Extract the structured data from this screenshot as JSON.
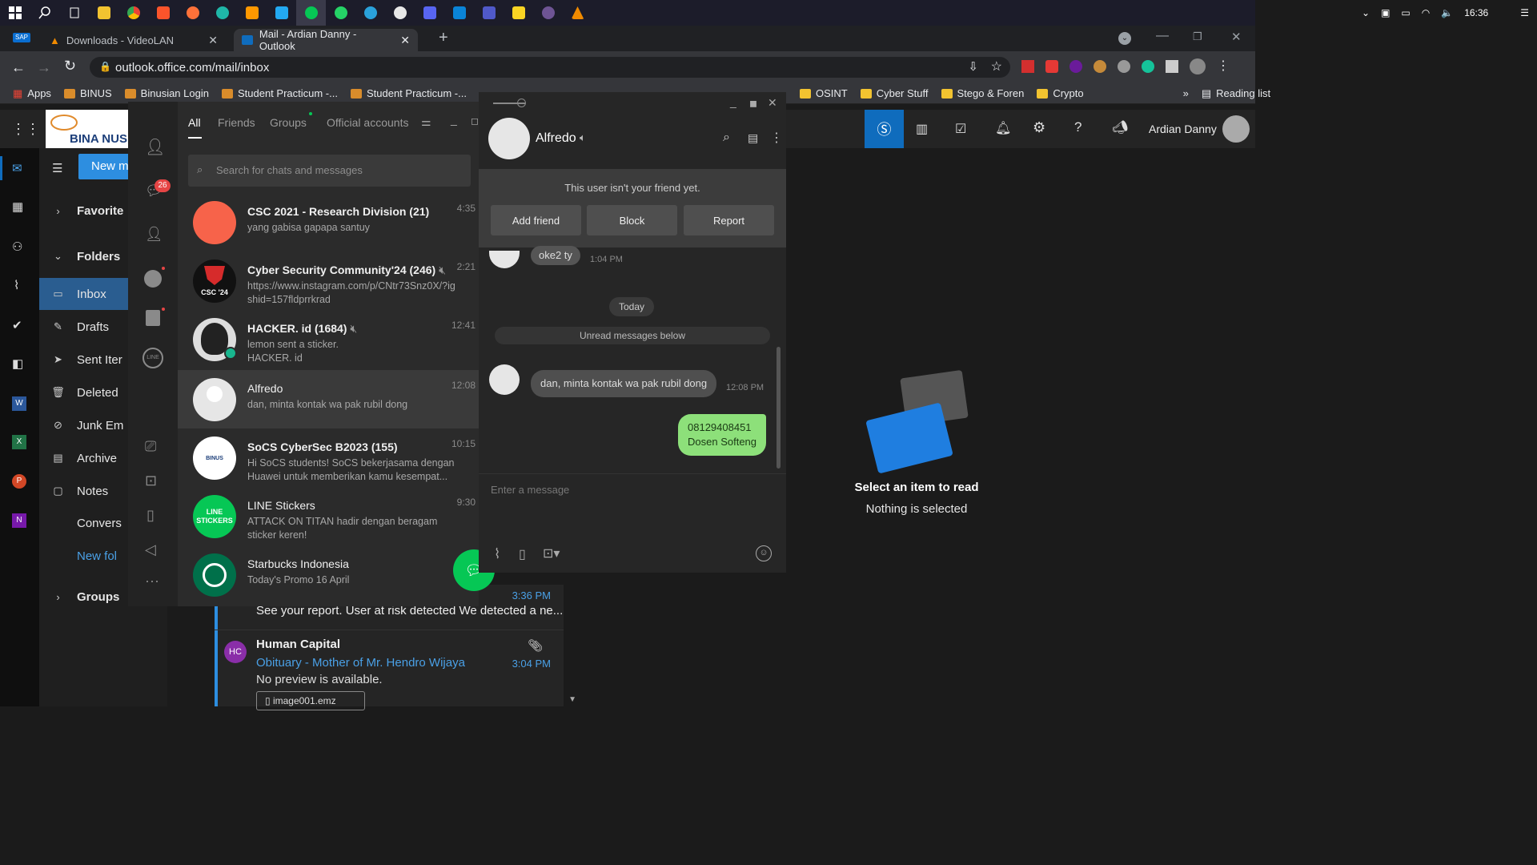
{
  "taskbar": {
    "clock": "16:36"
  },
  "browser": {
    "tabs": [
      {
        "title": "Downloads - VideoLAN"
      },
      {
        "title": "Mail - Ardian Danny - Outlook"
      }
    ],
    "url": "outlook.office.com/mail/inbox",
    "bookmarks": [
      "Apps",
      "BINUS",
      "Binusian Login",
      "Student Practicum -...",
      "Student Practicum -...",
      "OSINT",
      "Cyber Stuff",
      "Stego & Foren",
      "Crypto"
    ],
    "reading_list": "Reading list"
  },
  "outlook": {
    "user": "Ardian Danny",
    "logo_text": "BINA NUS",
    "new_message": "New m",
    "favorites": "Favorite",
    "folders": "Folders",
    "nav": [
      {
        "label": "Inbox",
        "icon": "inbox-icon"
      },
      {
        "label": "Drafts",
        "icon": "pencil-icon"
      },
      {
        "label": "Sent Iter",
        "icon": "send-icon"
      },
      {
        "label": "Deleted",
        "icon": "trash-icon"
      },
      {
        "label": "Junk Em",
        "icon": "block-icon"
      },
      {
        "label": "Archive",
        "icon": "archive-icon"
      },
      {
        "label": "Notes",
        "icon": "note-icon"
      },
      {
        "label": "Convers",
        "icon": ""
      },
      {
        "label": "New fol",
        "icon": ""
      }
    ],
    "groups": "Groups",
    "messages": [
      {
        "time": "3:36 PM",
        "preview": "See your report. User at risk detected We detected a ne..."
      },
      {
        "initials": "HC",
        "sender": "Human Capital",
        "subject": "Obituary - Mother of Mr. Hendro Wijaya",
        "time": "3:04 PM",
        "preview": "No preview is available.",
        "attachment": "image001.emz"
      }
    ],
    "reading": {
      "title": "Select an item to read",
      "subtitle": "Nothing is selected"
    },
    "accent": "#0f6cbd"
  },
  "line": {
    "tabs": [
      "All",
      "Friends",
      "Groups",
      "Official accounts"
    ],
    "badge": "26",
    "search_placeholder": "Search for chats and messages",
    "chats": [
      {
        "name": "CSC 2021 - Research Division (21)",
        "preview": "yang gabisa gapapa santuy",
        "time": "4:35"
      },
      {
        "name": "Cyber Security Community'24 (246)",
        "preview": "https://www.instagram.com/p/CNtr73Snz0X/?igshid=157fldprrkrad",
        "time": "2:21",
        "avatar_text": "CSC '24"
      },
      {
        "name": "HACKER. id (1684)",
        "preview": "lemon sent a sticker.\nHACKER. id",
        "time": "12:41"
      },
      {
        "name": "Alfredo",
        "preview": "dan, minta kontak wa pak rubil dong",
        "time": "12:08"
      },
      {
        "name": "SoCS CyberSec B2023 (155)",
        "preview": "Hi SoCS students!  SoCS bekerjasama dengan Huawei untuk memberikan kamu kesempat...",
        "time": "10:15",
        "avatar_text": "BINUS"
      },
      {
        "name": "LINE Stickers",
        "preview": "ATTACK ON TITAN hadir dengan beragam sticker keren!",
        "time": "9:30",
        "avatar_text": "LINE STICKERS"
      },
      {
        "name": "Starbucks Indonesia",
        "preview": "Today's Promo 16 April",
        "time": ""
      }
    ],
    "conversation": {
      "contact": "Alfredo",
      "not_friend": "This user isn't your friend yet.",
      "buttons": [
        "Add friend",
        "Block",
        "Report"
      ],
      "msg_prev": "oke2 ty",
      "msg_prev_time": "1:04 PM",
      "date_sep": "Today",
      "unread_sep": "Unread messages below",
      "incoming": "dan, minta kontak wa pak rubil dong",
      "incoming_time": "12:08 PM",
      "outgoing": "08129408451\nDosen Softeng",
      "input_placeholder": "Enter a message"
    },
    "green": "#06c755"
  }
}
